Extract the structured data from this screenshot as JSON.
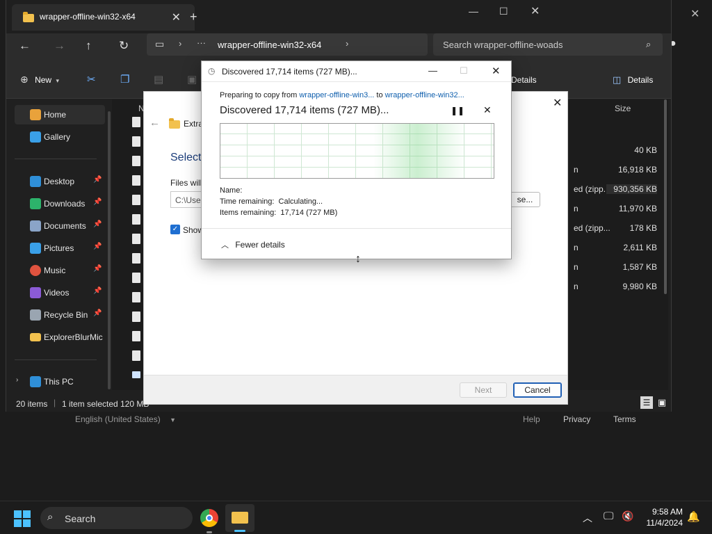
{
  "background_installer": {
    "language": "English (United States)",
    "help": "Help",
    "privacy": "Privacy",
    "terms": "Terms"
  },
  "explorer": {
    "tab_title": "wrapper-offline-win32-x64",
    "address": "wrapper-offline-win32-x64",
    "search_placeholder": "Search wrapper-offline-woads",
    "toolbar": {
      "new_label": "New",
      "details_label": "Details",
      "details_pane_label": "Details"
    },
    "column_name_partial": "N",
    "column_size": "Size",
    "sidebar": {
      "items": [
        {
          "label": "Home",
          "icon": "home-icon",
          "pinned": false
        },
        {
          "label": "Gallery",
          "icon": "gallery-icon",
          "pinned": false
        },
        {
          "label": "Desktop",
          "icon": "desktop-icon",
          "pinned": true
        },
        {
          "label": "Downloads",
          "icon": "downloads-icon",
          "pinned": true
        },
        {
          "label": "Documents",
          "icon": "documents-icon",
          "pinned": true
        },
        {
          "label": "Pictures",
          "icon": "pictures-icon",
          "pinned": true
        },
        {
          "label": "Music",
          "icon": "music-icon",
          "pinned": true
        },
        {
          "label": "Videos",
          "icon": "videos-icon",
          "pinned": true
        },
        {
          "label": "Recycle Bin",
          "icon": "recycle-bin-icon",
          "pinned": true
        },
        {
          "label": "ExplorerBlurMic",
          "icon": "folder-icon",
          "pinned": false
        },
        {
          "label": "This PC",
          "icon": "this-pc-icon",
          "pinned": false
        }
      ]
    },
    "files": [
      {
        "type": "",
        "size": "40 KB"
      },
      {
        "type": "n",
        "size": "16,918 KB"
      },
      {
        "type": "ed (zipp...",
        "size": "930,356 KB"
      },
      {
        "type": "n",
        "size": "11,970 KB"
      },
      {
        "type": "ed (zipp...",
        "size": "178 KB"
      },
      {
        "type": "n",
        "size": "2,611 KB"
      },
      {
        "type": "n",
        "size": "1,587 KB"
      },
      {
        "type": "n",
        "size": "9,980 KB"
      }
    ],
    "status": {
      "count": "20 items",
      "selected": "1 item selected",
      "selected_size": "120 MB"
    }
  },
  "installer": {
    "crumb": "Extra",
    "heading": "Select",
    "files_label": "Files will",
    "path_value": "C:\\User",
    "browse_label": "se...",
    "show_label": "Show",
    "next_label": "Next",
    "cancel_label": "Cancel"
  },
  "copy_dialog": {
    "window_title": "Discovered 17,714 items (727 MB)...",
    "prep_prefix": "Preparing to copy from",
    "source": "wrapper-offline-win3...",
    "to_word": "to",
    "dest": "wrapper-offline-win32...",
    "status_title": "Discovered 17,714 items (727 MB)...",
    "name_label": "Name:",
    "time_label": "Time remaining:",
    "time_value": "Calculating...",
    "items_label": "Items remaining:",
    "items_value": "17,714 (727 MB)",
    "fewer_details": "Fewer details"
  },
  "taskbar": {
    "search_label": "Search",
    "time": "9:58 AM",
    "date": "11/4/2024"
  }
}
